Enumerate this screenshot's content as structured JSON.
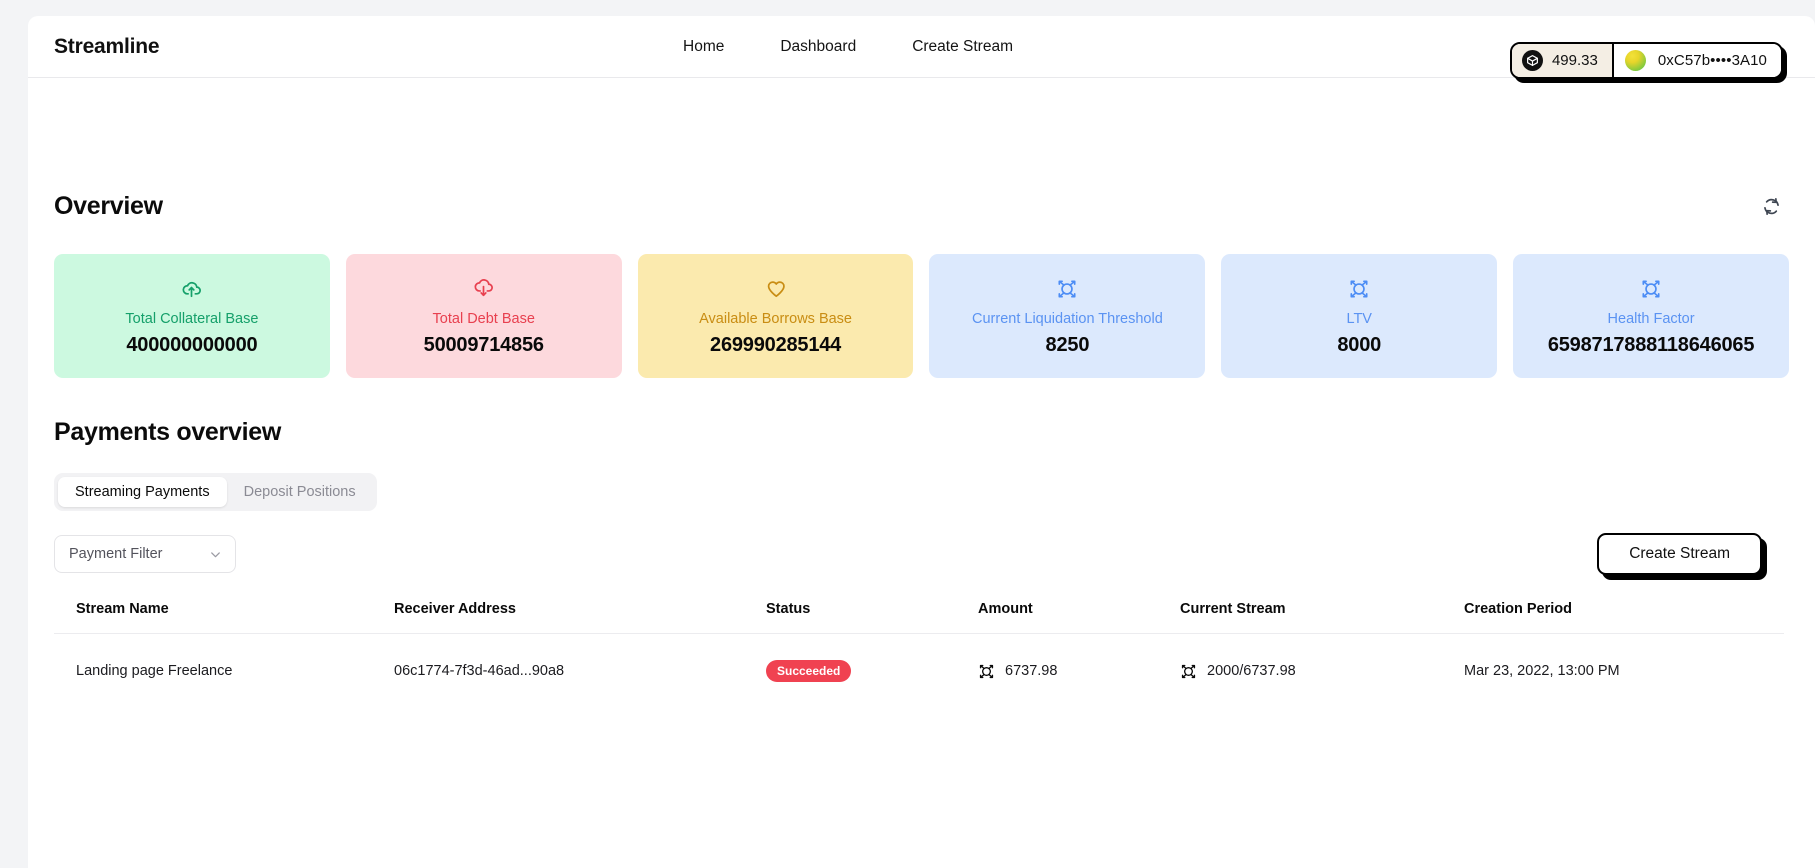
{
  "header": {
    "brand": "Streamline",
    "nav": [
      {
        "label": "Home",
        "name": "nav-link-home"
      },
      {
        "label": "Dashboard",
        "name": "nav-link-dashboard"
      },
      {
        "label": "Create Stream",
        "name": "nav-link-create-stream"
      }
    ],
    "wallet": {
      "balance": "499.33",
      "token_icon": "cube-icon",
      "address": "0xC57b••••3A10",
      "avatar_icon": "wallet-avatar"
    }
  },
  "overview": {
    "title": "Overview",
    "refresh_icon": "refresh-icon",
    "cards": [
      {
        "label": "Total Collateral Base",
        "value": "400000000000",
        "icon": "cloud-upload-icon",
        "variant": "card-green",
        "accent": "#15a06a"
      },
      {
        "label": "Total Debt Base",
        "value": "50009714856",
        "icon": "cloud-download-icon",
        "variant": "card-red",
        "accent": "#e8404f"
      },
      {
        "label": "Available Borrows Base",
        "value": "269990285144",
        "icon": "heart-icon",
        "variant": "card-yellow",
        "accent": "#c98d13"
      },
      {
        "label": "Current Liquidation Threshold",
        "value": "8250",
        "icon": "target-focus-icon",
        "variant": "card-blue",
        "accent": "#5b93f2"
      },
      {
        "label": "LTV",
        "value": "8000",
        "icon": "target-focus-icon",
        "variant": "card-blue",
        "accent": "#5b93f2"
      },
      {
        "label": "Health Factor",
        "value": "6598717888118646065",
        "icon": "target-focus-icon",
        "variant": "card-blue",
        "accent": "#5b93f2"
      }
    ]
  },
  "payments": {
    "title": "Payments overview",
    "tabs": [
      {
        "label": "Streaming Payments",
        "active": true
      },
      {
        "label": "Deposit Positions",
        "active": false
      }
    ],
    "filter": {
      "placeholder": "Payment Filter",
      "chevron_icon": "chevron-down-icon",
      "options": [
        "Payment Filter"
      ]
    },
    "create_stream_label": "Create Stream",
    "table": {
      "columns": [
        "Stream Name",
        "Receiver Address",
        "Status",
        "Amount",
        "Current Stream",
        "Creation Period"
      ],
      "rows": [
        {
          "stream_name": "Landing page Freelance",
          "receiver_address": "06c1774-7f3d-46ad...90a8",
          "status": "Succeeded",
          "status_color": "#f04251",
          "amount": "6737.98",
          "amount_icon": "token-glyph-icon",
          "current_stream": "2000/6737.98",
          "current_stream_icon": "token-glyph-icon",
          "creation_period": "Mar 23, 2022, 13:00 PM"
        }
      ]
    }
  }
}
